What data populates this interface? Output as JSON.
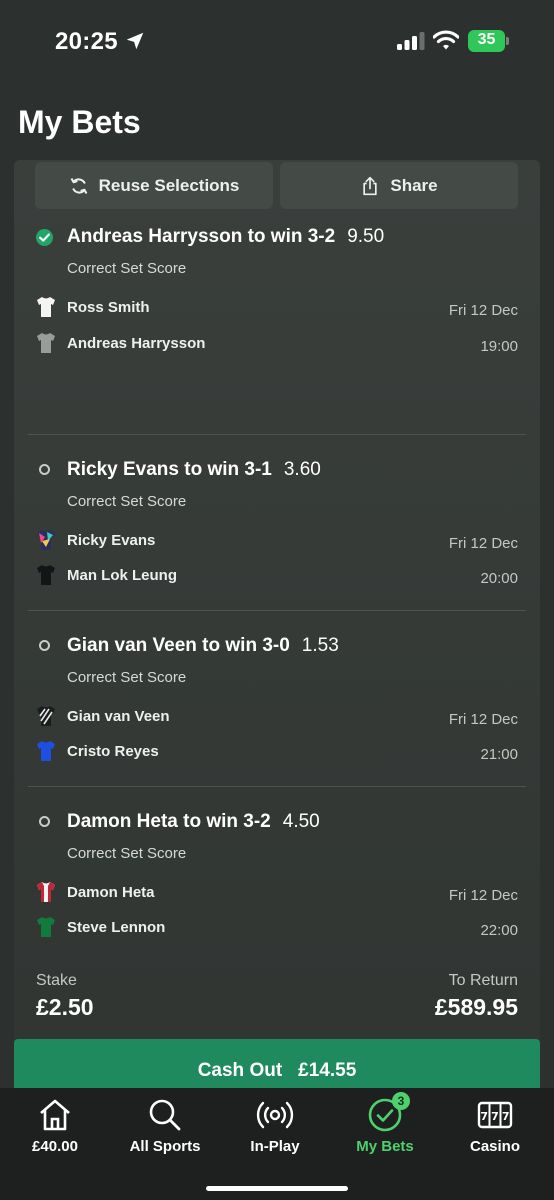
{
  "status_bar": {
    "time": "20:25",
    "battery": "35"
  },
  "header": {
    "title": "My Bets"
  },
  "actions": {
    "reuse_label": "Reuse Selections",
    "share_label": "Share"
  },
  "selections": [
    {
      "title": "Andreas Harrysson to win 3-2",
      "odds": "9.50",
      "status": "won",
      "market": "Correct Set Score",
      "player1": "Ross Smith",
      "player2": "Andreas Harrysson",
      "date": "Fri 12 Dec",
      "time": "19:00"
    },
    {
      "title": "Ricky Evans to win 3-1",
      "odds": "3.60",
      "status": "pending",
      "market": "Correct Set Score",
      "player1": "Ricky Evans",
      "player2": "Man Lok Leung",
      "date": "Fri 12 Dec",
      "time": "20:00"
    },
    {
      "title": "Gian van Veen to win 3-0",
      "odds": "1.53",
      "status": "pending",
      "market": "Correct Set Score",
      "player1": "Gian van Veen",
      "player2": "Cristo Reyes",
      "date": "Fri 12 Dec",
      "time": "21:00"
    },
    {
      "title": "Damon Heta to win 3-2",
      "odds": "4.50",
      "status": "pending",
      "market": "Correct Set Score",
      "player1": "Damon Heta",
      "player2": "Steve Lennon",
      "date": "Fri 12 Dec",
      "time": "22:00"
    }
  ],
  "summary": {
    "stake_label": "Stake",
    "stake_value": "£2.50",
    "return_label": "To Return",
    "return_value": "£589.95"
  },
  "cashout": {
    "label": "Cash Out",
    "amount": "£14.55"
  },
  "tabs": [
    {
      "label": "£40.00",
      "icon": "home-icon"
    },
    {
      "label": "All Sports",
      "icon": "search-icon"
    },
    {
      "label": "In-Play",
      "icon": "broadcast-icon"
    },
    {
      "label": "My Bets",
      "icon": "check-circle-icon",
      "badge": "3",
      "active": true
    },
    {
      "label": "Casino",
      "icon": "slot-machine-icon"
    }
  ],
  "colors": {
    "accent_green": "#4fd06e",
    "cashout_green": "#1f8a5d",
    "won_green": "#21a56a",
    "background": "#2c302e"
  }
}
